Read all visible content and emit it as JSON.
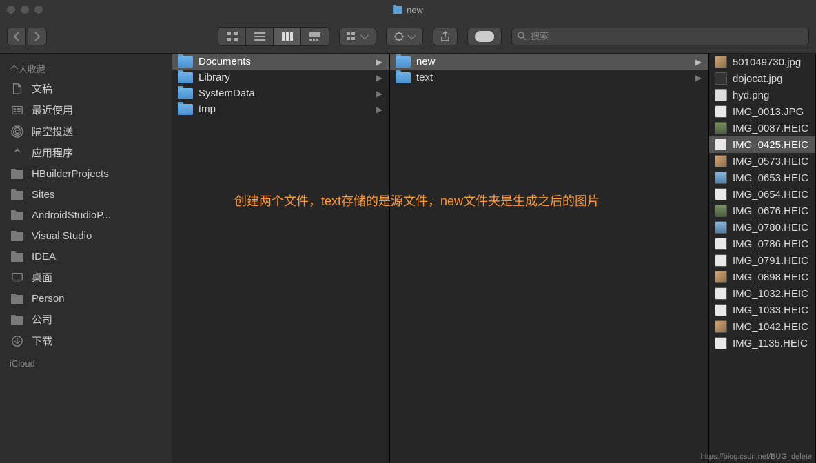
{
  "window": {
    "title": "new"
  },
  "search": {
    "placeholder": "搜索"
  },
  "sidebar": {
    "section_favorites": "个人收藏",
    "section_icloud": "iCloud",
    "items": [
      {
        "label": "文稿",
        "icon": "doc"
      },
      {
        "label": "最近使用",
        "icon": "recent"
      },
      {
        "label": "隔空投送",
        "icon": "airdrop"
      },
      {
        "label": "应用程序",
        "icon": "apps"
      },
      {
        "label": "HBuilderProjects",
        "icon": "folder"
      },
      {
        "label": "Sites",
        "icon": "folder"
      },
      {
        "label": "AndroidStudioP...",
        "icon": "folder"
      },
      {
        "label": "Visual Studio",
        "icon": "folder"
      },
      {
        "label": "IDEA",
        "icon": "folder"
      },
      {
        "label": "桌面",
        "icon": "desktop"
      },
      {
        "label": "Person",
        "icon": "folder"
      },
      {
        "label": "公司",
        "icon": "folder"
      },
      {
        "label": "下载",
        "icon": "download"
      }
    ]
  },
  "columns": [
    {
      "items": [
        {
          "label": "Documents",
          "type": "folder",
          "selected": true,
          "hasChildren": true
        },
        {
          "label": "Library",
          "type": "folder",
          "hasChildren": true
        },
        {
          "label": "SystemData",
          "type": "folder",
          "hasChildren": true
        },
        {
          "label": "tmp",
          "type": "folder",
          "hasChildren": true
        }
      ]
    },
    {
      "items": [
        {
          "label": "new",
          "type": "folder",
          "selected": true,
          "hasChildren": true
        },
        {
          "label": "text",
          "type": "folder",
          "hasChildren": true
        }
      ]
    },
    {
      "items": [
        {
          "label": "501049730.jpg",
          "type": "file",
          "thumb": "img"
        },
        {
          "label": "dojocat.jpg",
          "type": "file",
          "thumb": "dark"
        },
        {
          "label": "hyd.png",
          "type": "file",
          "thumb": "png"
        },
        {
          "label": "IMG_0013.JPG",
          "type": "file",
          "thumb": "light"
        },
        {
          "label": "IMG_0087.HEIC",
          "type": "file",
          "thumb": "green"
        },
        {
          "label": "IMG_0425.HEIC",
          "type": "file",
          "thumb": "light",
          "selected": true
        },
        {
          "label": "IMG_0573.HEIC",
          "type": "file",
          "thumb": "img"
        },
        {
          "label": "IMG_0653.HEIC",
          "type": "file",
          "thumb": "blue"
        },
        {
          "label": "IMG_0654.HEIC",
          "type": "file",
          "thumb": "light"
        },
        {
          "label": "IMG_0676.HEIC",
          "type": "file",
          "thumb": "green"
        },
        {
          "label": "IMG_0780.HEIC",
          "type": "file",
          "thumb": "blue"
        },
        {
          "label": "IMG_0786.HEIC",
          "type": "file",
          "thumb": "light"
        },
        {
          "label": "IMG_0791.HEIC",
          "type": "file",
          "thumb": "light"
        },
        {
          "label": "IMG_0898.HEIC",
          "type": "file",
          "thumb": "img"
        },
        {
          "label": "IMG_1032.HEIC",
          "type": "file",
          "thumb": "light"
        },
        {
          "label": "IMG_1033.HEIC",
          "type": "file",
          "thumb": "light"
        },
        {
          "label": "IMG_1042.HEIC",
          "type": "file",
          "thumb": "img"
        },
        {
          "label": "IMG_1135.HEIC",
          "type": "file",
          "thumb": "light"
        }
      ]
    }
  ],
  "annotation": "创建两个文件，text存储的是源文件，new文件夹是生成之后的图片",
  "watermark": "https://blog.csdn.net/BUG_delete"
}
